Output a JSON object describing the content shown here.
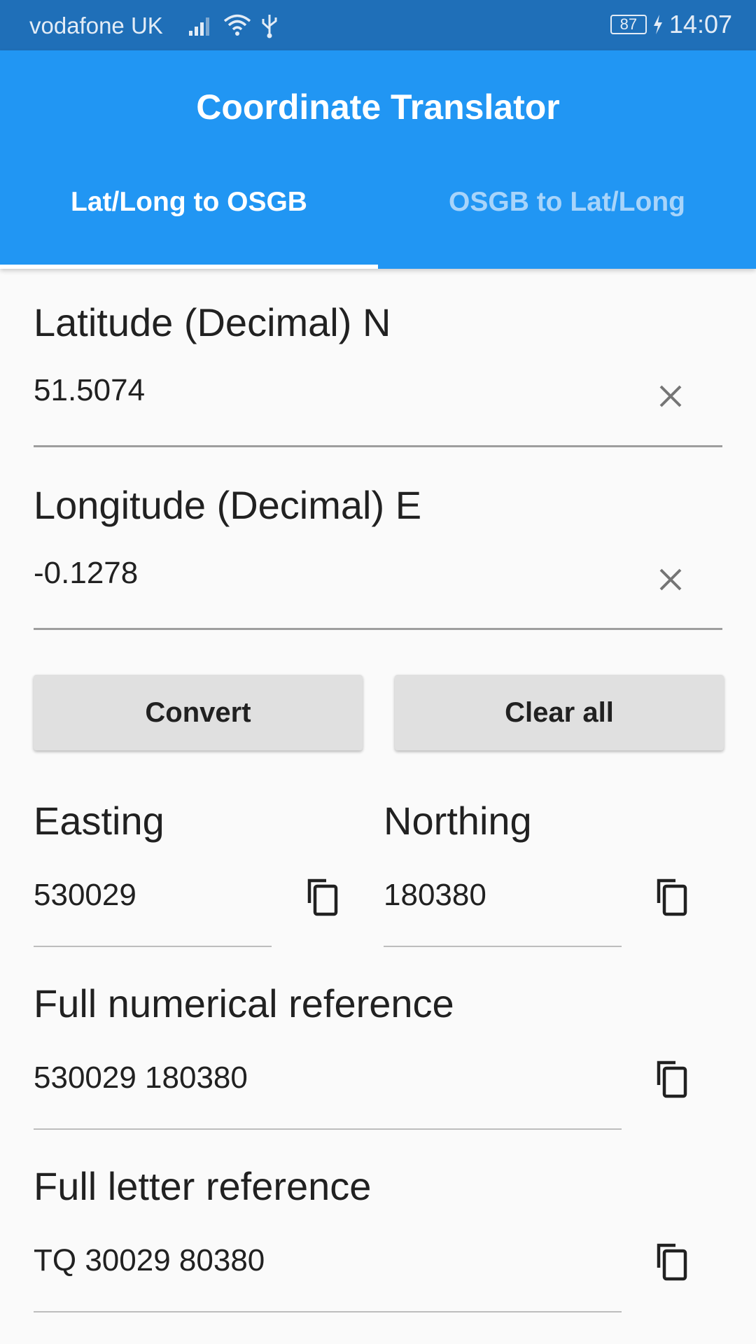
{
  "status_bar": {
    "carrier": "vodafone UK",
    "battery": "87",
    "time": "14:07"
  },
  "app": {
    "title": "Coordinate Translator",
    "tabs": [
      {
        "label": "Lat/Long to OSGB",
        "selected": true
      },
      {
        "label": "OSGB to Lat/Long",
        "selected": false
      }
    ]
  },
  "form": {
    "latitude": {
      "label": "Latitude (Decimal) N",
      "value": "51.5074"
    },
    "longitude": {
      "label": "Longitude (Decimal) E",
      "value": "-0.1278"
    },
    "convert_label": "Convert",
    "clear_all_label": "Clear all"
  },
  "results": {
    "easting": {
      "label": "Easting",
      "value": "530029"
    },
    "northing": {
      "label": "Northing",
      "value": "180380"
    },
    "full_numerical": {
      "label": "Full numerical reference",
      "value": "530029 180380"
    },
    "full_letter": {
      "label": "Full letter reference",
      "value": "TQ 30029 80380"
    }
  },
  "colors": {
    "status_bar": "#1f6fb8",
    "app_bar": "#2196f3",
    "button": "#e0e0e0",
    "background": "#fafafa"
  },
  "icons": {
    "clear": "close-icon",
    "copy": "copy-icon",
    "signal": "signal-icon",
    "wifi": "wifi-icon",
    "usb": "usb-icon",
    "charging": "charging-icon"
  }
}
